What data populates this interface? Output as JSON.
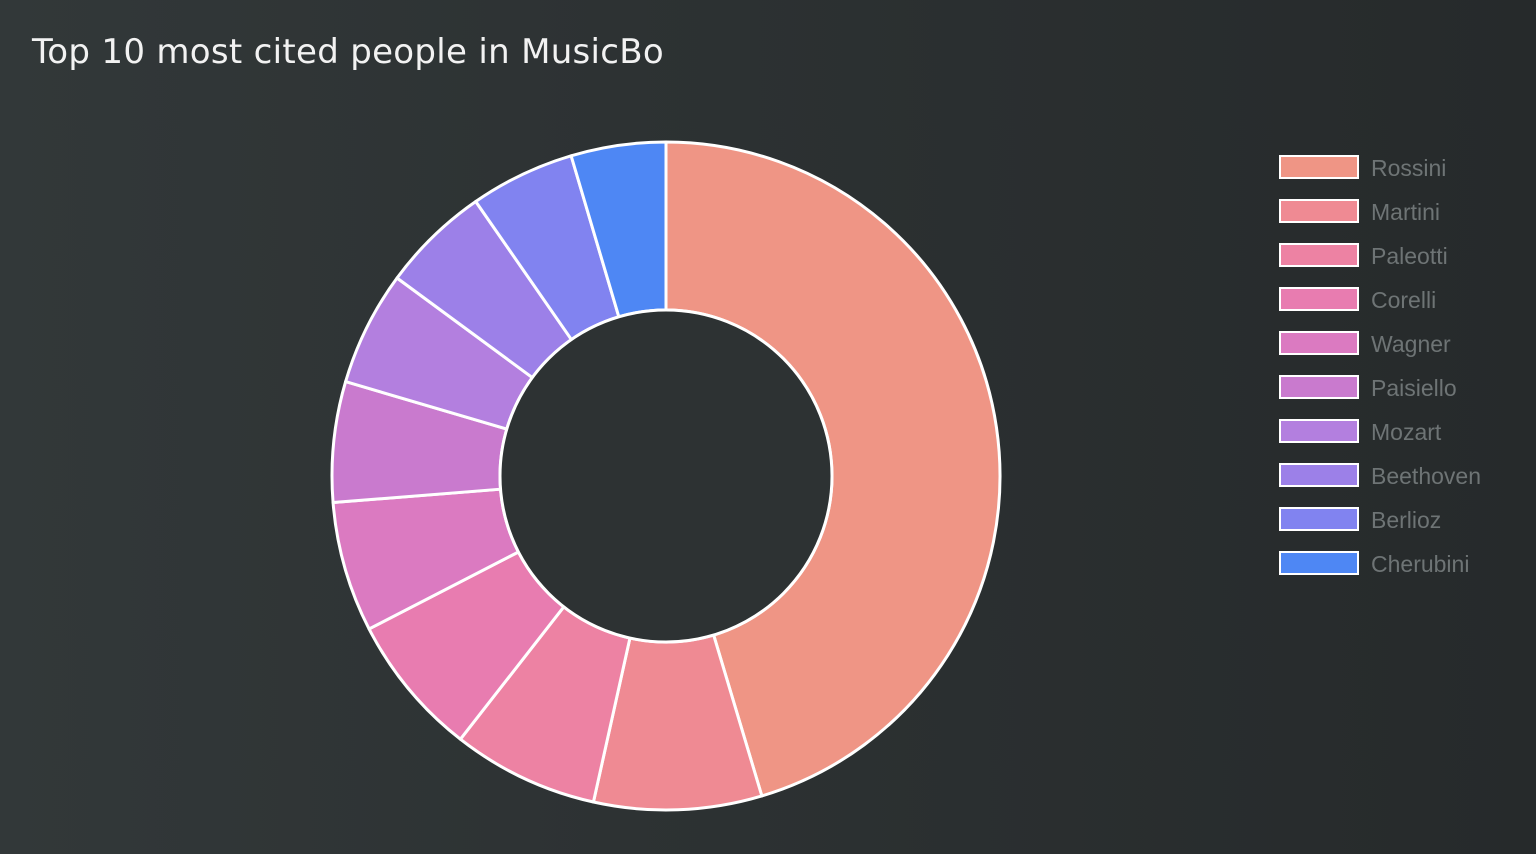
{
  "page": {
    "title": "Top 10 most cited people in MusicBo"
  },
  "chart_data": {
    "type": "pie",
    "variant": "doughnut",
    "title": "Top 10 most cited people in MusicBo",
    "categories": [
      "Rossini",
      "Martini",
      "Paleotti",
      "Corelli",
      "Wagner",
      "Paisiello",
      "Mozart",
      "Beethoven",
      "Berlioz",
      "Cherubini"
    ],
    "values": [
      47.5,
      8.5,
      7.4,
      7.2,
      6.6,
      6.1,
      5.8,
      5.5,
      5.3,
      4.8
    ],
    "colors": [
      "#ef9585",
      "#ef8a93",
      "#ed82a3",
      "#e87cb0",
      "#db7ac1",
      "#c97ace",
      "#b37fdf",
      "#9c80e8",
      "#8183f0",
      "#4e87f4"
    ],
    "slice_border_color": "#ffffff",
    "hole_color": "#2d3233",
    "start_angle": "top",
    "direction": "clockwise",
    "legend_position": "right"
  }
}
